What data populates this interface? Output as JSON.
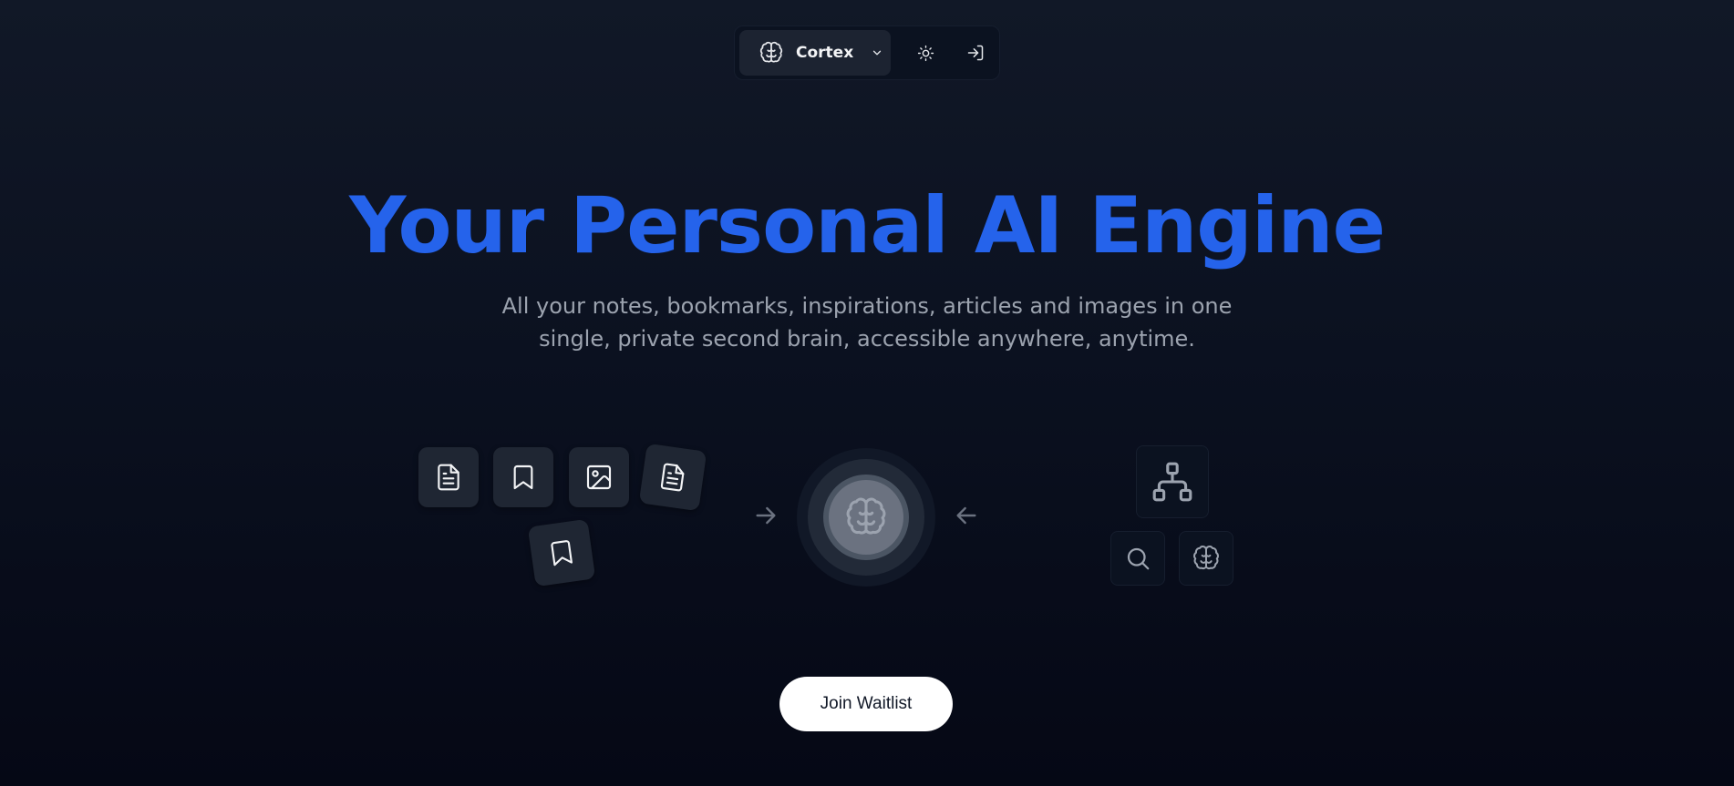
{
  "nav": {
    "brand_name": "Cortex",
    "brand_icon": "brain-icon",
    "dropdown_icon": "chevron-down-icon",
    "theme_toggle_icon": "sun-icon",
    "login_icon": "log-in-icon"
  },
  "hero": {
    "title": "Your Personal AI Engine",
    "subtitle": "All your notes, bookmarks, inspirations, articles and images in one single, private second brain, accessible anywhere, anytime."
  },
  "illustration": {
    "input_icons": [
      "file-text-icon",
      "bookmark-icon",
      "image-icon",
      "file-text-icon",
      "bookmark-icon"
    ],
    "core_icon": "brain-icon",
    "output_icons": [
      "network-icon",
      "search-icon",
      "brain-icon"
    ],
    "flow_arrows": [
      "arrow-right-icon",
      "arrow-left-icon"
    ]
  },
  "cta": {
    "label": "Join Waitlist"
  },
  "colors": {
    "accent": "#2563eb",
    "background_top": "#111827",
    "background_bottom": "#050815",
    "tile": "#1f2633",
    "subtitle": "#9ca3af",
    "button_bg": "#ffffff",
    "button_text": "#111827"
  }
}
